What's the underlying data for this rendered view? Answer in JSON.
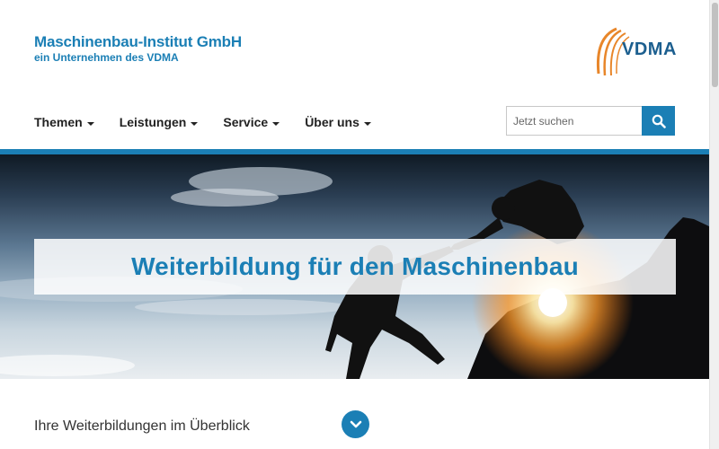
{
  "header": {
    "brand_name": "Maschinenbau-Institut GmbH",
    "brand_sub": "ein Unternehmen des VDMA",
    "logo_text": "VDMA"
  },
  "nav": {
    "items": [
      {
        "label": "Themen"
      },
      {
        "label": "Leistungen"
      },
      {
        "label": "Service"
      },
      {
        "label": "Über uns"
      }
    ]
  },
  "search": {
    "placeholder": "Jetzt suchen",
    "value": "",
    "icon": "search-icon"
  },
  "hero": {
    "title_bold": "Weiterbildung",
    "title_rest": " für den Maschinenbau"
  },
  "section": {
    "overview_label": "Ihre Weiterbildungen im Überblick",
    "scroll_icon": "chevron-down-icon"
  },
  "colors": {
    "accent": "#1b7fb5",
    "logo_orange": "#e8862a",
    "logo_blue": "#1c5f8f"
  }
}
